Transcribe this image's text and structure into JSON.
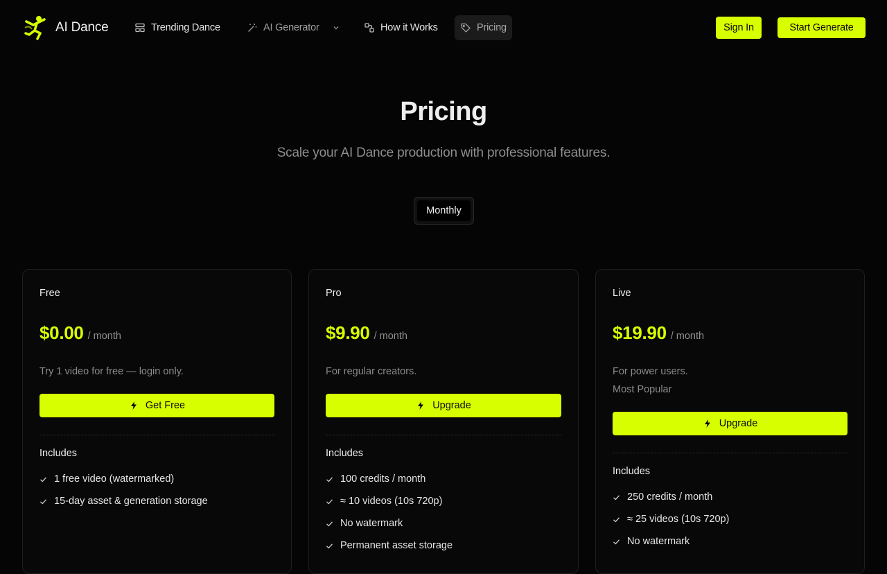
{
  "brand": {
    "name": "AI Dance",
    "accent": "#d8ff00"
  },
  "nav": {
    "items": [
      {
        "label": "Trending Dance",
        "icon": "layout-icon"
      },
      {
        "label": "AI Generator",
        "icon": "magic-wand-icon"
      },
      {
        "label": "How it Works",
        "icon": "workflow-icon"
      },
      {
        "label": "Pricing",
        "icon": "tag-icon"
      }
    ],
    "sign_in": "Sign In",
    "start": "Start Generate"
  },
  "hero": {
    "title": "Pricing",
    "subtitle": "Scale your AI Dance production with professional features.",
    "billing_toggle": "Monthly"
  },
  "plans": [
    {
      "name": "Free",
      "price": "$0.00",
      "period": "/ month",
      "desc_lines": [
        "Try 1 video for free — login only."
      ],
      "cta": "Get Free",
      "includes_label": "Includes",
      "features": [
        "1 free video (watermarked)",
        "15-day asset & generation storage"
      ]
    },
    {
      "name": "Pro",
      "price": "$9.90",
      "period": "/ month",
      "desc_lines": [
        "For regular creators."
      ],
      "cta": "Upgrade",
      "includes_label": "Includes",
      "features": [
        "100 credits / month",
        "≈ 10 videos (10s 720p)",
        "No watermark",
        "Permanent asset storage"
      ]
    },
    {
      "name": "Live",
      "price": "$19.90",
      "period": "/ month",
      "desc_lines": [
        "For power users.",
        "Most Popular"
      ],
      "cta": "Upgrade",
      "includes_label": "Includes",
      "features": [
        "250 credits / month",
        "≈ 25 videos (10s 720p)",
        "No watermark"
      ]
    }
  ]
}
